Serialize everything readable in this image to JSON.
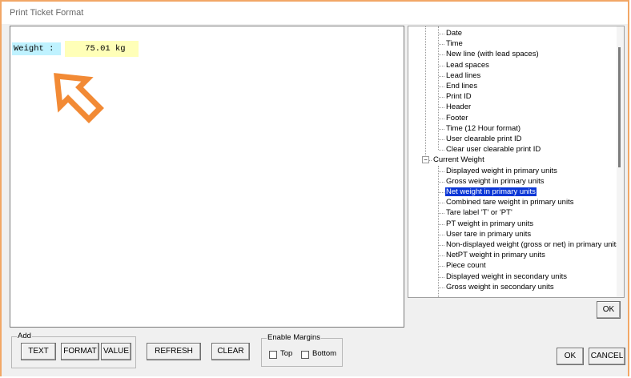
{
  "window": {
    "title": "Print Ticket Format"
  },
  "ticket": {
    "label": "Weight : ",
    "value": "    75.01 kg"
  },
  "tree": {
    "items": [
      {
        "label": "Date",
        "level": 2
      },
      {
        "label": "Time",
        "level": 2
      },
      {
        "label": "New line (with lead spaces)",
        "level": 2
      },
      {
        "label": "Lead spaces",
        "level": 2
      },
      {
        "label": "Lead lines",
        "level": 2
      },
      {
        "label": "End lines",
        "level": 2
      },
      {
        "label": "Print ID",
        "level": 2
      },
      {
        "label": "Header",
        "level": 2
      },
      {
        "label": "Footer",
        "level": 2
      },
      {
        "label": "Time (12 Hour format)",
        "level": 2
      },
      {
        "label": "User clearable print ID",
        "level": 2
      },
      {
        "label": "Clear user clearable print ID",
        "level": 2
      },
      {
        "label": "Current Weight",
        "level": 1,
        "expander": "−"
      },
      {
        "label": "Displayed weight in primary units",
        "level": 2
      },
      {
        "label": "Gross weight in primary units",
        "level": 2
      },
      {
        "label": "Net weight in primary units",
        "level": 2,
        "selected": true
      },
      {
        "label": "Combined tare weight in primary units",
        "level": 2
      },
      {
        "label": "Tare label 'T' or 'PT'",
        "level": 2
      },
      {
        "label": "PT weight in primary units",
        "level": 2
      },
      {
        "label": "User tare in primary units",
        "level": 2
      },
      {
        "label": "Non-displayed weight (gross or net) in primary units",
        "level": 2
      },
      {
        "label": "NetPT weight in primary units",
        "level": 2
      },
      {
        "label": "Piece count",
        "level": 2
      },
      {
        "label": "Displayed weight in secondary units",
        "level": 2
      },
      {
        "label": "Gross weight in secondary units",
        "level": 2
      }
    ]
  },
  "buttons": {
    "tree_ok": "OK",
    "text": "TEXT",
    "format": "FORMAT",
    "value": "VALUE",
    "refresh": "REFRESH",
    "clear": "CLEAR",
    "ok": "OK",
    "cancel": "CANCEL"
  },
  "groups": {
    "add": "Add",
    "margins": "Enable Margins"
  },
  "margins": {
    "top": "Top",
    "bottom": "Bottom"
  },
  "colors": {
    "selection": "#0a36d6",
    "label_bg": "#bff2ff",
    "value_bg": "#ffffb8",
    "arrow": "#f28a35"
  }
}
